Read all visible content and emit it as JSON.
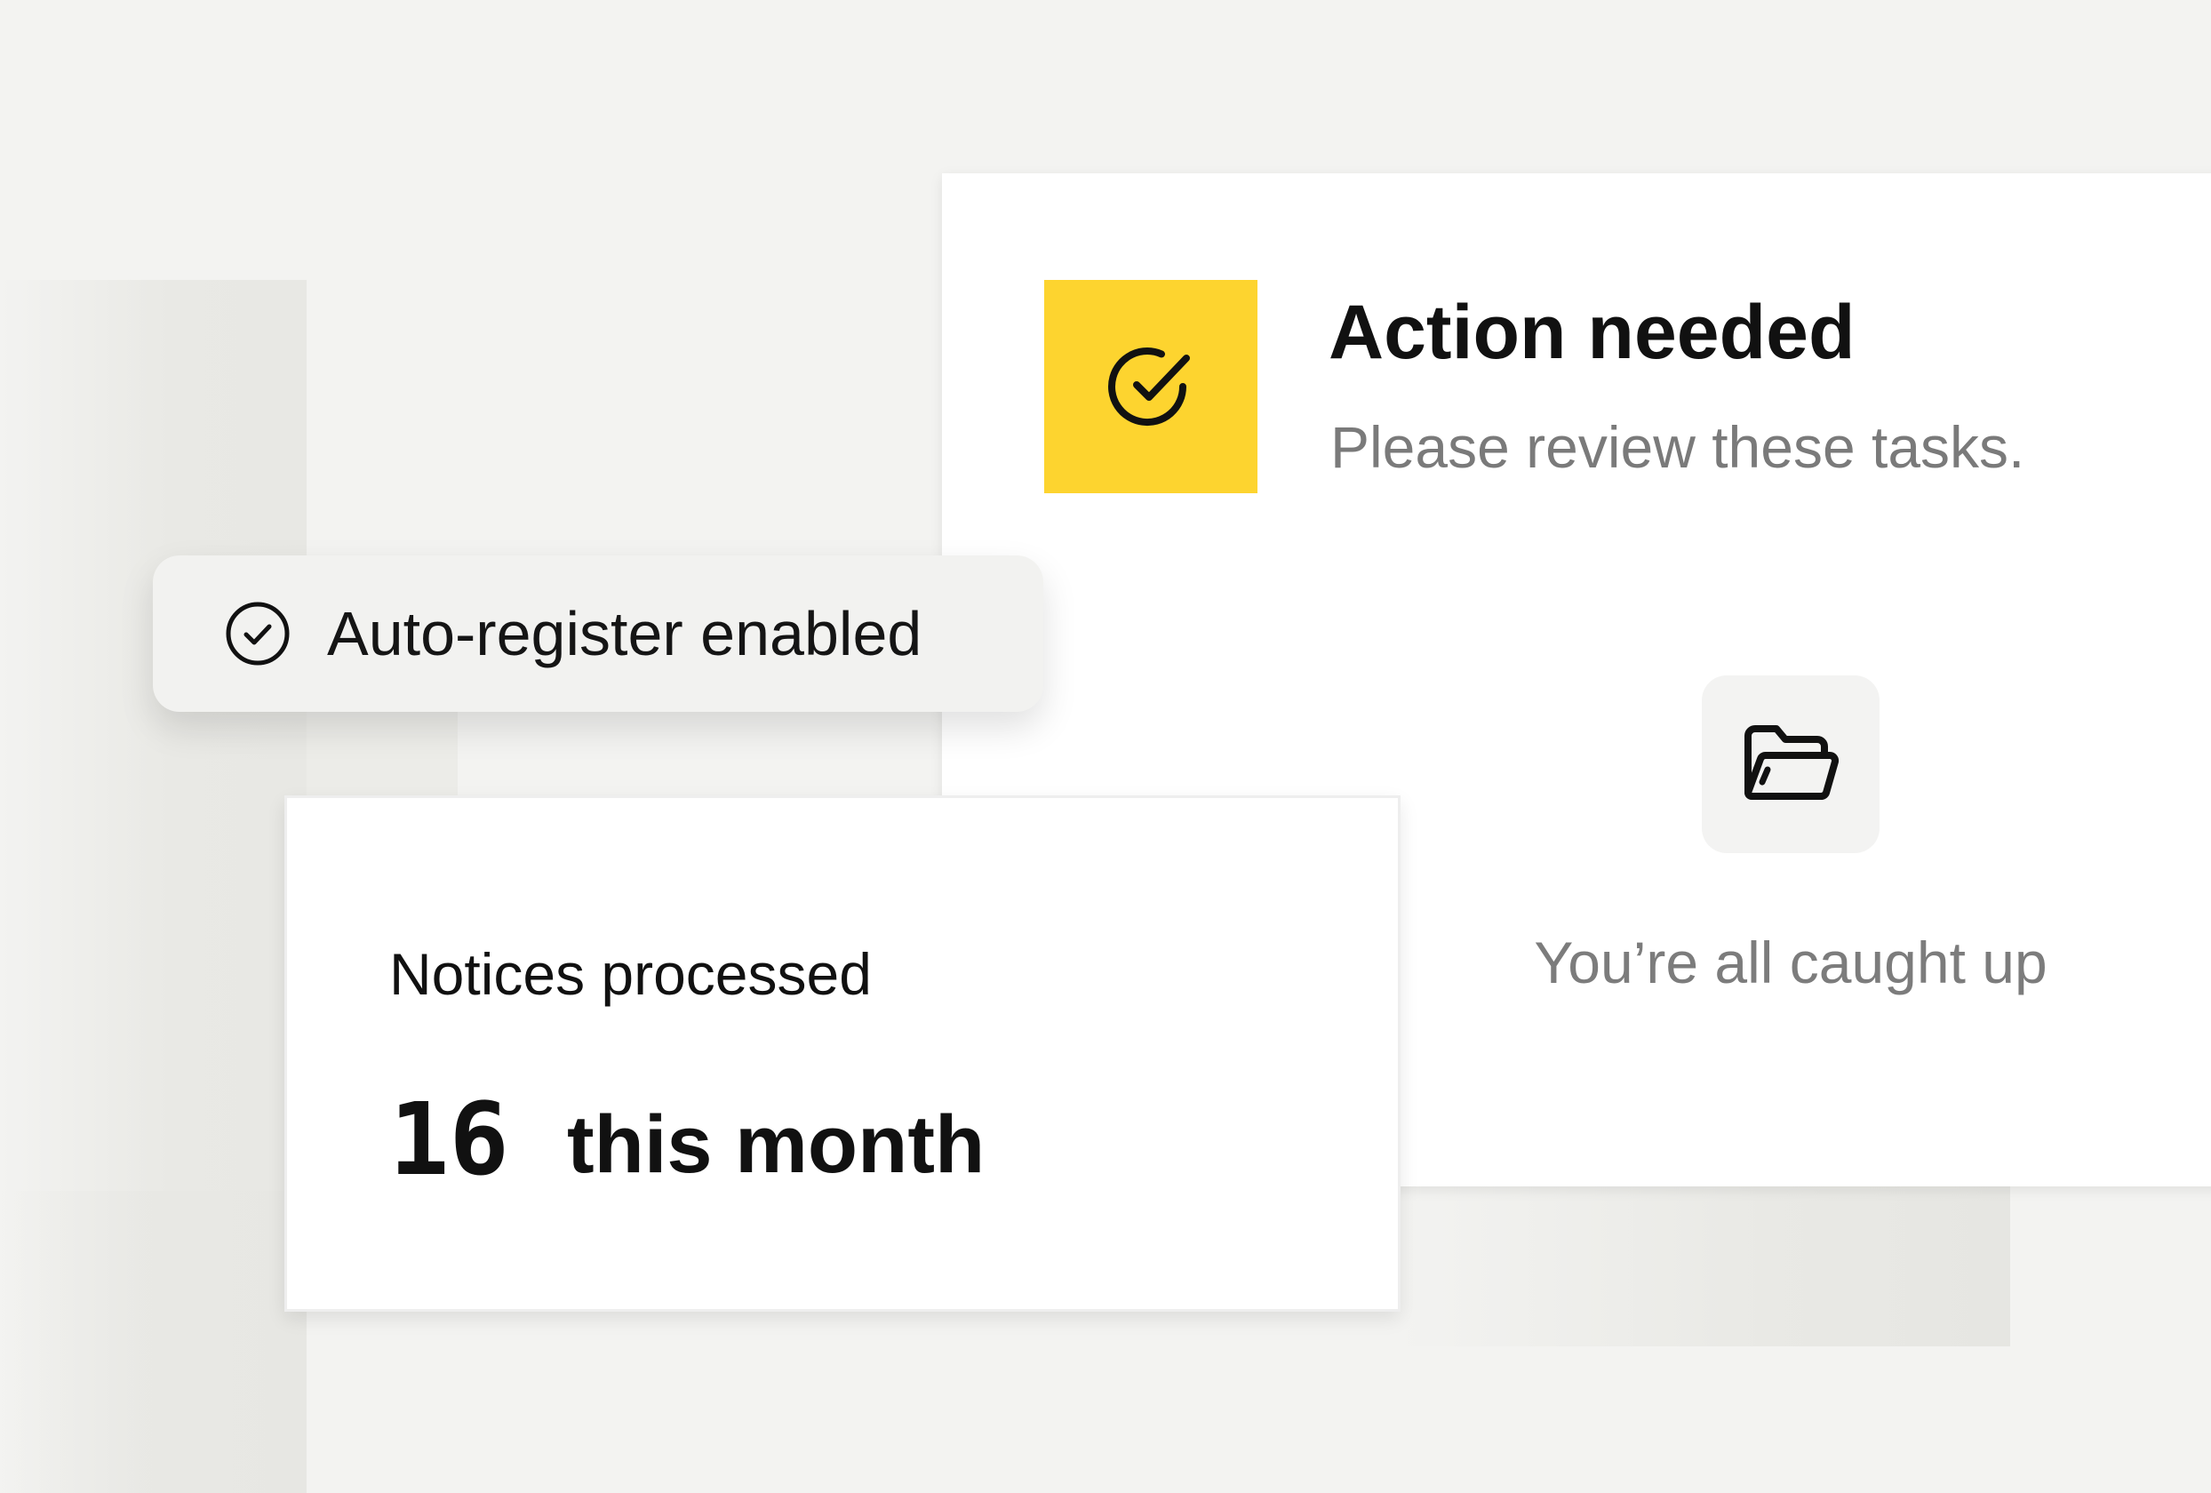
{
  "action_card": {
    "title": "Action needed",
    "subtitle": "Please review these tasks.",
    "icon": "check-circle-icon",
    "accent_color": "#fdd42f",
    "empty_icon": "folder-open-icon",
    "empty_text": "You’re all caught up"
  },
  "auto_register": {
    "icon": "check-circle-icon",
    "label": "Auto-register enabled"
  },
  "notices": {
    "title": "Notices processed",
    "count": "16",
    "period": "this month"
  }
}
